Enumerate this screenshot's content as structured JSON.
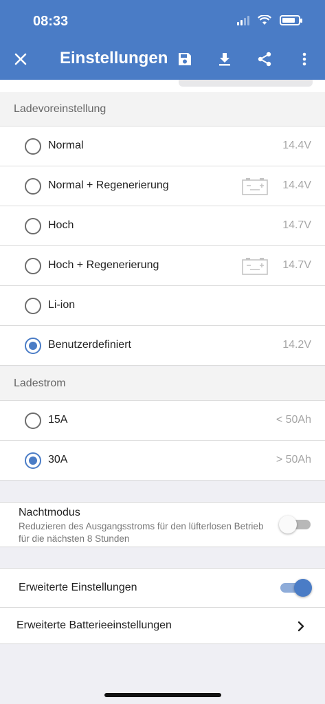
{
  "status_bar": {
    "time": "08:33"
  },
  "toolbar": {
    "title": "Einstellungen",
    "close_icon": "close-icon",
    "save_icon": "save-icon",
    "download_icon": "download-icon",
    "share_icon": "share-icon",
    "more_icon": "more-vert-icon"
  },
  "charge_preset": {
    "label": "Ladevoreinstellung",
    "options": [
      {
        "label": "Normal",
        "value": "14.4V",
        "selected": false,
        "battery_icon": false
      },
      {
        "label": "Normal + Regenerierung",
        "value": "14.4V",
        "selected": false,
        "battery_icon": true
      },
      {
        "label": "Hoch",
        "value": "14.7V",
        "selected": false,
        "battery_icon": false
      },
      {
        "label": "Hoch + Regenerierung",
        "value": "14.7V",
        "selected": false,
        "battery_icon": true
      },
      {
        "label": "Li-ion",
        "value": "",
        "selected": false,
        "battery_icon": false
      },
      {
        "label": "Benutzerdefiniert",
        "value": "14.2V",
        "selected": true,
        "battery_icon": false
      }
    ]
  },
  "charge_current": {
    "label": "Ladestrom",
    "options": [
      {
        "label": "15A",
        "value": "< 50Ah",
        "selected": false
      },
      {
        "label": "30A",
        "value": "> 50Ah",
        "selected": true
      }
    ]
  },
  "night_mode": {
    "title": "Nachtmodus",
    "description": "Reduzieren des Ausgangsstroms für den lüfterlosen Betrieb für die nächsten 8 Stunden",
    "enabled": false
  },
  "advanced": {
    "settings_label": "Erweiterte Einstellungen",
    "settings_enabled": true,
    "battery_settings_label": "Erweiterte Batterieeinstellungen",
    "chevron_icon": "chevron-right-icon"
  },
  "colors": {
    "accent": "#4a7cc6",
    "background": "#efeff4",
    "muted_text": "#a5a5a5"
  }
}
